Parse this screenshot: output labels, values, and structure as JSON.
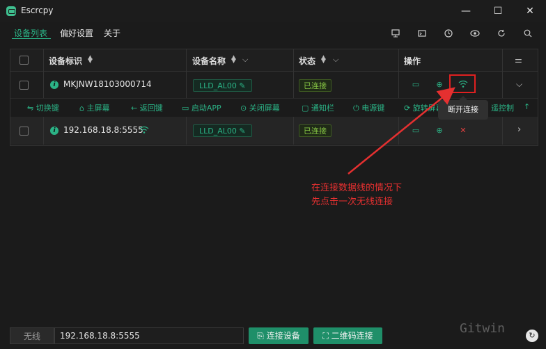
{
  "window": {
    "title": "Escrcpy"
  },
  "nav": {
    "tabs": [
      "设备列表",
      "偏好设置",
      "关于"
    ],
    "icons": [
      "screen-icon",
      "terminal-icon",
      "clock-icon",
      "eye-icon",
      "refresh-icon",
      "search-icon"
    ]
  },
  "table": {
    "headers": {
      "device_id": "设备标识",
      "device_name": "设备名称",
      "status": "状态",
      "actions": "操作"
    },
    "rows": [
      {
        "id": "MKJNW18103000714",
        "name": "LLD_AL00",
        "status": "已连接"
      },
      {
        "id": "192.168.18.8:5555",
        "name": "LLD_AL00",
        "status": "已连接"
      }
    ],
    "toolbar": [
      "⇋ 切换键",
      "⌂ 主屏幕",
      "← 返回键",
      "▭ 启动APP",
      "⊙ 关闭屏幕",
      "▢ 通知栏",
      "⏻ 电源键",
      "⟳ 旋转屏幕",
      "遥控制",
      "↑"
    ]
  },
  "tooltip": "断开连接",
  "annotation": {
    "line1": "在连接数据线的情况下",
    "line2": "先点击一次无线连接"
  },
  "bottom": {
    "label": "无线",
    "address": "192.168.18.8:5555",
    "connect_button": "连接设备",
    "qr_button": "二维码连接"
  },
  "watermark": "Gitwin",
  "colors": {
    "accent": "#2bb386",
    "status_green": "#86c544",
    "annotation_red": "#e53030"
  }
}
